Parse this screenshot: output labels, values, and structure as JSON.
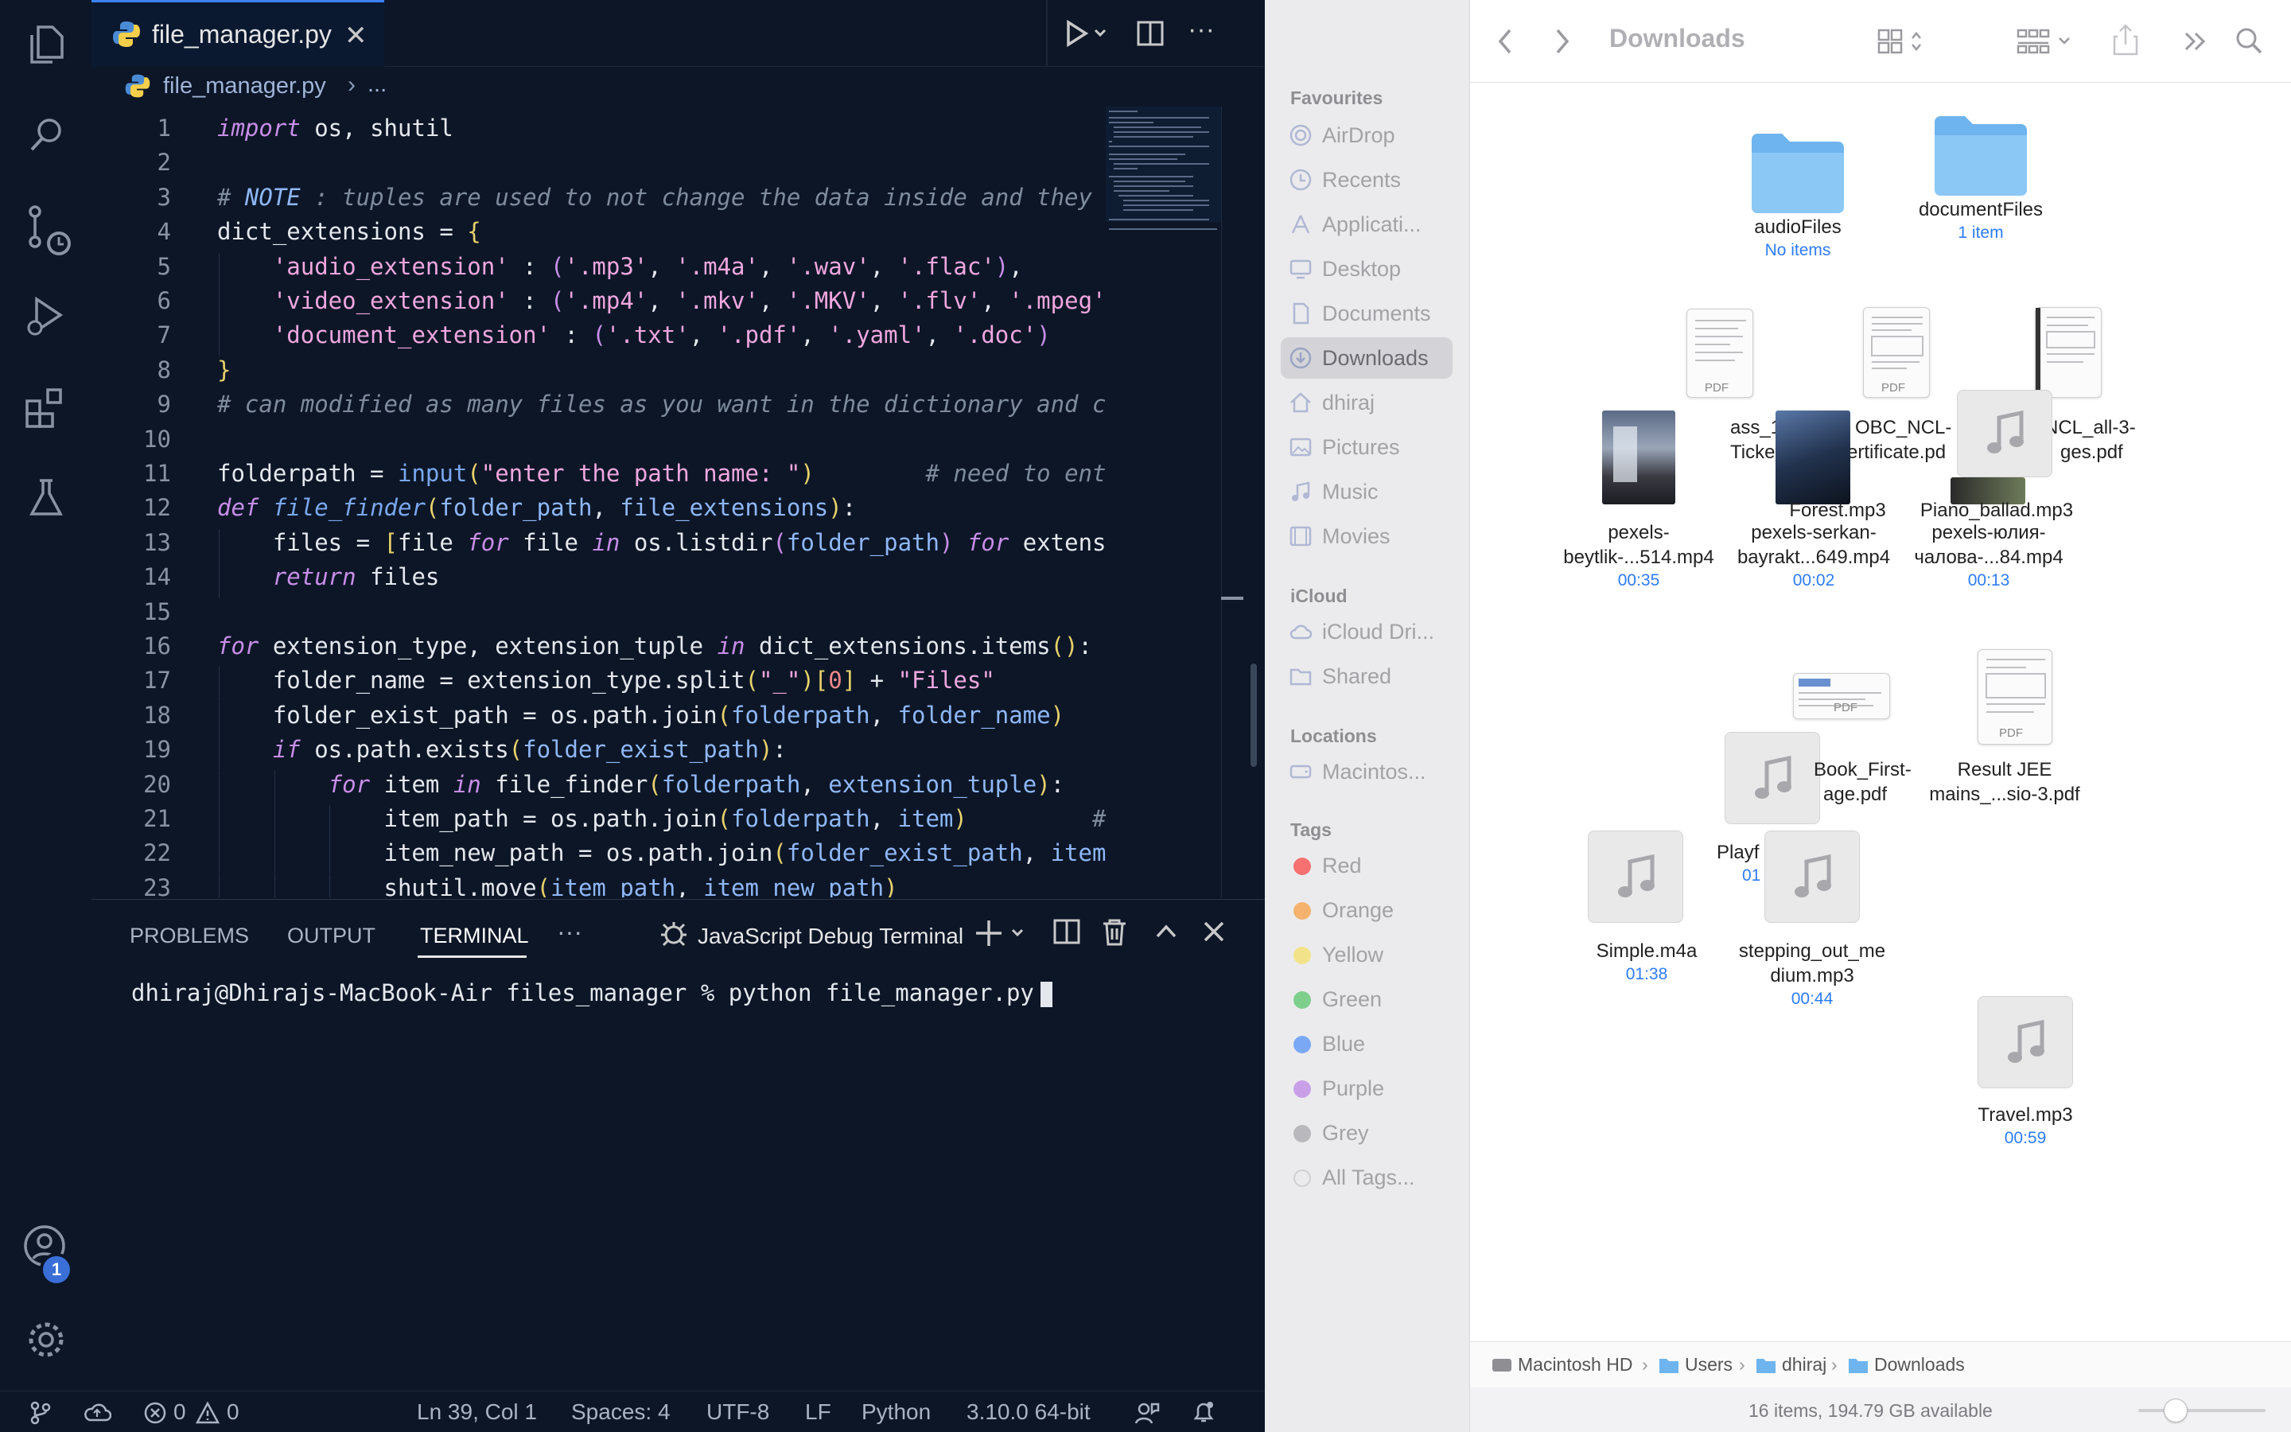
{
  "vscode": {
    "tab": {
      "filename": "file_manager.py",
      "close": "✕"
    },
    "breadcrumb": {
      "file": "file_manager.py",
      "sep": "›",
      "more": "..."
    },
    "code_lines": [
      {
        "n": "1",
        "html": "<span class=\"kw\">import</span> os, shutil"
      },
      {
        "n": "2",
        "html": ""
      },
      {
        "n": "3",
        "html": "<span class=\"cm\"># <span style=\"color:#8fb8f8\">NOTE</span> : tuples are used to not change the data inside and they</span>"
      },
      {
        "n": "4",
        "html": "dict_extensions = <span class=\"pu\">{</span>"
      },
      {
        "n": "5",
        "html": "    <span class=\"st\">'audio_extension'</span> : <span class=\"pa\">(</span><span class=\"st\">'.mp3'</span>, <span class=\"st\">'.m4a'</span>, <span class=\"st\">'.wav'</span>, <span class=\"st\">'.flac'</span><span class=\"pa\">)</span>,"
      },
      {
        "n": "6",
        "html": "    <span class=\"st\">'video_extension'</span> : <span class=\"pa\">(</span><span class=\"st\">'.mp4'</span>, <span class=\"st\">'.mkv'</span>, <span class=\"st\">'.MKV'</span>, <span class=\"st\">'.flv'</span>, <span class=\"st\">'.mpeg'</span>"
      },
      {
        "n": "7",
        "html": "    <span class=\"st\">'document_extension'</span> : <span class=\"pa\">(</span><span class=\"st\">'.txt'</span>, <span class=\"st\">'.pdf'</span>, <span class=\"st\">'.yaml'</span>, <span class=\"st\">'.doc'</span><span class=\"pa\">)</span>"
      },
      {
        "n": "8",
        "html": "<span class=\"pu\">}</span>"
      },
      {
        "n": "9",
        "html": "<span class=\"cm\"># can modified as many files as you want in the dictionary and c</span>"
      },
      {
        "n": "10",
        "html": ""
      },
      {
        "n": "11",
        "html": "folderpath = <span class=\"fn\" style=\"font-style:normal\">input</span><span class=\"pu\">(</span><span class=\"st\">\"enter the path name: \"</span><span class=\"pu\">)</span>        <span class=\"cm\"># need to ent</span>"
      },
      {
        "n": "12",
        "html": "<span class=\"kw\">def</span> <span class=\"fn\">file_finder</span><span class=\"pu\">(</span><span class=\"va\">folder_path</span>, <span class=\"va\">file_extensions</span><span class=\"pu\">)</span>:"
      },
      {
        "n": "13",
        "html": "    files = <span class=\"pu\">[</span>file <span class=\"kw\">for</span> file <span class=\"kw\">in</span> os.listdir<span class=\"pa\">(</span><span class=\"va\">folder_path</span><span class=\"pa\">)</span> <span class=\"kw\">for</span> extens"
      },
      {
        "n": "14",
        "html": "    <span class=\"kw\">return</span> files"
      },
      {
        "n": "15",
        "html": ""
      },
      {
        "n": "16",
        "html": "<span class=\"kw\">for</span> extension_type, extension_tuple <span class=\"kw\">in</span> dict_extensions.items<span class=\"pu\">()</span>:"
      },
      {
        "n": "17",
        "html": "    folder_name = extension_type.split<span class=\"pu\">(</span><span class=\"st\">\"_\"</span><span class=\"pu\">)</span><span class=\"pu\">[</span><span class=\"nm\">0</span><span class=\"pu\">]</span> + <span class=\"st\">\"Files\"</span>"
      },
      {
        "n": "18",
        "html": "    folder_exist_path = os.path.join<span class=\"pu\">(</span><span class=\"va\">folderpath</span>, <span class=\"va\">folder_name</span><span class=\"pu\">)</span>"
      },
      {
        "n": "19",
        "html": "    <span class=\"kw\">if</span> os.path.exists<span class=\"pu\">(</span><span class=\"va\">folder_exist_path</span><span class=\"pu\">)</span>:"
      },
      {
        "n": "20",
        "html": "        <span class=\"kw\">for</span> item <span class=\"kw\">in</span> file_finder<span class=\"pu\">(</span><span class=\"va\">folderpath</span>, <span class=\"va\">extension_tuple</span><span class=\"pu\">)</span>:"
      },
      {
        "n": "21",
        "html": "            item_path = os.path.join<span class=\"pu\">(</span><span class=\"va\">folderpath</span>, <span class=\"va\">item</span><span class=\"pu\">)</span>         <span class=\"cm\">#</span>"
      },
      {
        "n": "22",
        "html": "            item_new_path = os.path.join<span class=\"pu\">(</span><span class=\"va\">folder_exist_path</span>, <span class=\"va\">item</span>"
      },
      {
        "n": "23",
        "html": "            shutil.move<span class=\"pu\">(</span><span class=\"va\">item_path</span>, <span class=\"va\">item_new_path</span><span class=\"pu\">)</span>"
      }
    ],
    "panel": {
      "tabs": [
        "PROBLEMS",
        "OUTPUT",
        "TERMINAL"
      ],
      "more": "···",
      "terminal_name": "JavaScript Debug Terminal",
      "prompt": "dhiraj@Dhirajs-MacBook-Air files_manager % python file_manager.py"
    },
    "status": {
      "errors": "0",
      "warnings": "0",
      "position": "Ln 39, Col 1",
      "spaces": "Spaces: 4",
      "encoding": "UTF-8",
      "eol": "LF",
      "language": "Python",
      "interpreter": "3.10.0 64-bit",
      "account_badge": "1"
    }
  },
  "finder": {
    "title": "Downloads",
    "sidebar": {
      "favourites_label": "Favourites",
      "favourites": [
        "AirDrop",
        "Recents",
        "Applicati...",
        "Desktop",
        "Documents",
        "Downloads",
        "dhiraj",
        "Pictures",
        "Music",
        "Movies"
      ],
      "icloud_label": "iCloud",
      "icloud": [
        "iCloud Dri...",
        "Shared"
      ],
      "locations_label": "Locations",
      "locations": [
        "Macintos..."
      ],
      "tags_label": "Tags",
      "tags": [
        "Red",
        "Orange",
        "Yellow",
        "Green",
        "Blue",
        "Purple",
        "Grey",
        "All Tags..."
      ],
      "tag_colors": [
        "#f87171",
        "#f4b26e",
        "#f2e38a",
        "#7fcf8c",
        "#7aa8f5",
        "#c9a0e8",
        "#b9b9bd",
        "#d0d0d4"
      ]
    },
    "items": {
      "audioFiles": {
        "name": "audioFiles",
        "sub": "No items"
      },
      "documentFiles": {
        "name": "documentFiles",
        "sub": "1 item"
      },
      "pdf1": {
        "name": "ass_12_Hal",
        "name2": "Ticket.pdf"
      },
      "pdf2": {
        "name": "OBC_NCL-",
        "name2": "ertificate.pd"
      },
      "pdf3": {
        "name": "NCL_all-3-",
        "name2": "ges.pdf"
      },
      "forest": {
        "name": "Forest.mp3"
      },
      "piano": {
        "name": "Piano_ballad.mp3"
      },
      "vid1": {
        "name": "pexels-",
        "name2": "beytlik-...514.mp4",
        "sub": "00:35"
      },
      "vid2": {
        "name": "pexels-serkan-",
        "name2": "bayrakt...649.mp4",
        "sub": "00:02"
      },
      "vid3": {
        "name": "pexels-юлия-",
        "name2": "чалова-...84.mp4",
        "sub": "00:13"
      },
      "book": {
        "name": "Book_First-",
        "name2": "age.pdf"
      },
      "jee": {
        "name": "Result JEE",
        "name2": "mains_...sio-3.pdf"
      },
      "playful": {
        "name": "Playf",
        "sub": "01"
      },
      "simple": {
        "name": "Simple.m4a",
        "sub": "01:38"
      },
      "stepping": {
        "name": "stepping_out_me",
        "name2": "dium.mp3",
        "sub": "00:44"
      },
      "travel": {
        "name": "Travel.mp3",
        "sub": "00:59"
      },
      "pdf_label": "PDF"
    },
    "pathbar": [
      "Macintosh HD",
      "Users",
      "dhiraj",
      "Downloads"
    ],
    "status": "16 items, 194.79 GB available"
  }
}
